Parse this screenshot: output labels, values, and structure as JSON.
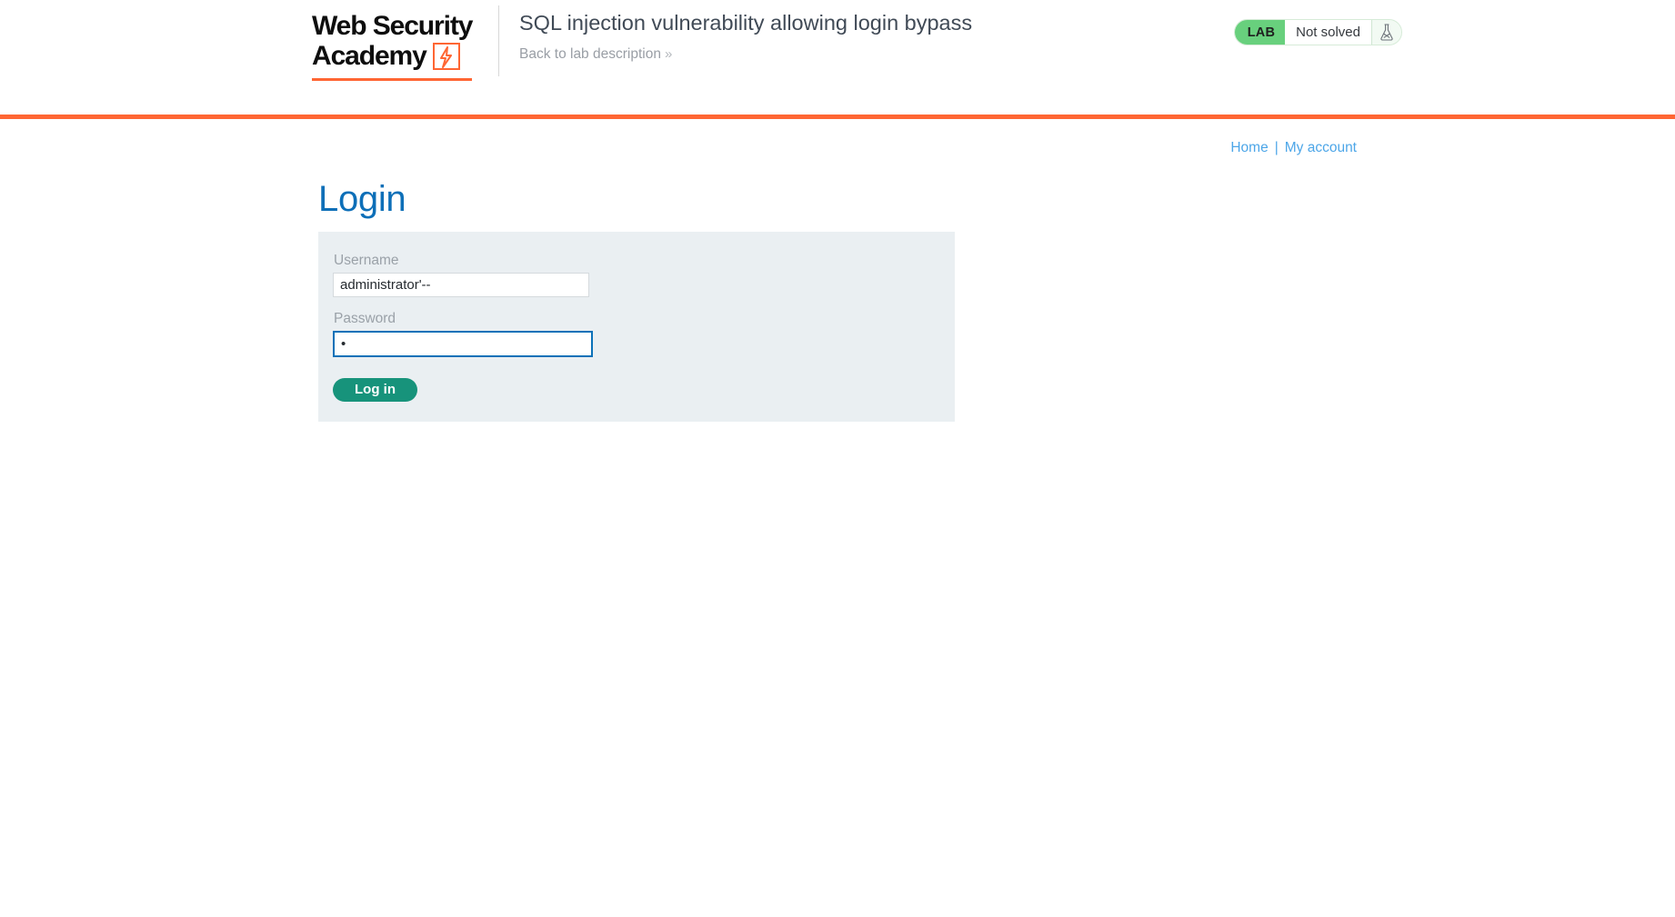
{
  "header": {
    "logo": {
      "line1": "Web Security",
      "line2": "Academy",
      "bolt_icon": "lightning-bolt-icon"
    },
    "lab_title": "SQL injection vulnerability allowing login bypass",
    "back_link": "Back to lab description",
    "back_chevron": "»",
    "status": {
      "tag": "LAB",
      "state": "Not solved",
      "flask_icon": "flask-not-solved-icon"
    }
  },
  "nav": {
    "home": "Home",
    "separator": "|",
    "my_account": "My account"
  },
  "main": {
    "heading": "Login",
    "form": {
      "username_label": "Username",
      "username_value": "administrator'--",
      "username_placeholder": "",
      "password_label": "Password",
      "password_value": "•",
      "password_placeholder": "",
      "submit_label": "Log in"
    }
  },
  "colors": {
    "brand_orange": "#ff6633",
    "lab_green": "#68d07d",
    "heading_blue": "#0d6fb8",
    "link_blue": "#4da6e8",
    "button_teal": "#17937b",
    "panel_gray": "#eaeff2",
    "focus_blue": "#0b71b8"
  }
}
